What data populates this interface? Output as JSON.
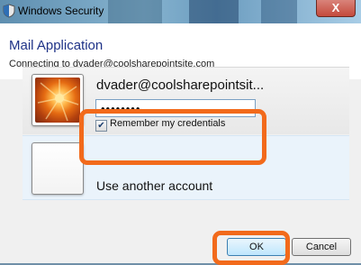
{
  "window": {
    "title": "Windows Security",
    "close_glyph": "X"
  },
  "header": {
    "app_title": "Mail Application",
    "connecting_text": "Connecting to dvader@coolsharepointsite.com"
  },
  "credentials": {
    "username": "dvader@coolsharepointsit...",
    "password_mask": "••••••••",
    "remember_checked": true,
    "remember_label": "Remember my credentials"
  },
  "other_account": {
    "label": "Use another account"
  },
  "buttons": {
    "ok": "OK",
    "cancel": "Cancel"
  },
  "icons": {
    "window_icon": "shield-icon",
    "avatar_image": "flower-avatar",
    "checkbox": "checkmark-icon"
  },
  "colors": {
    "highlight": "#f26a1b",
    "title_blue": "#1e3287",
    "selected_tile": "#eaf3fb"
  }
}
